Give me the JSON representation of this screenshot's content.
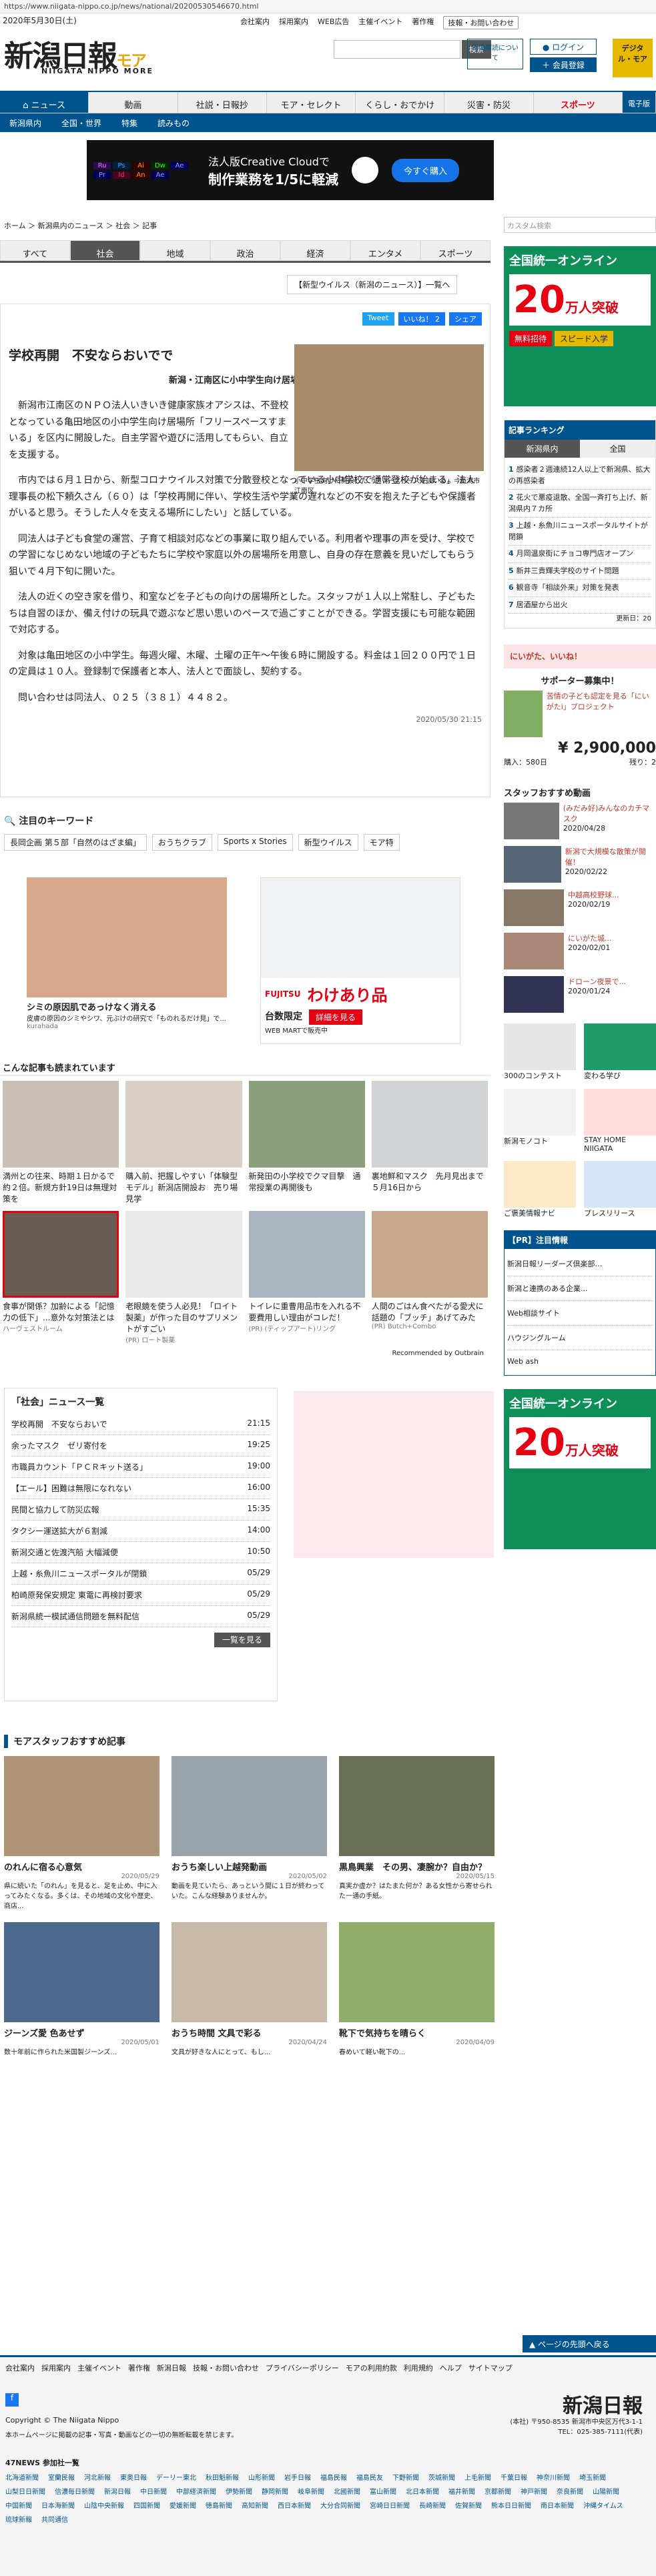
{
  "browser": {
    "url": "https://www.niigata-nippo.co.jp/news/national/20200530546670.html"
  },
  "header": {
    "date": "2020年5月30日(土)",
    "top_links": [
      "会社案内",
      "採用案内",
      "WEB広告",
      "主催イベント",
      "著作権"
    ],
    "contact_link": "技報・お問い合わせ",
    "logo_main": "新潟日報",
    "logo_more": "モア",
    "logo_sub": "NIIGATA NIPPO MORE",
    "search_btn": "検索",
    "member_btn": "新聞購読について",
    "login_btn": "ログイン",
    "register_btn": "会員登録",
    "digital_badge": "デジタル・モア"
  },
  "nav": {
    "items": [
      "ニュース",
      "動画",
      "社説・日報抄",
      "モア・セレクト",
      "くらし・おでかけ",
      "災害・防災",
      "スポーツ"
    ],
    "epaper": "電子版",
    "sub_items": [
      "新潟県内",
      "全国・世界",
      "特集",
      "読みもの"
    ]
  },
  "ad_banner": {
    "apps": [
      "Ru",
      "Ps",
      "Ai",
      "Dw",
      "Ae",
      "Pr",
      "Id",
      "An",
      "Ae"
    ],
    "text1": "法人版Creative Cloudで",
    "text2": "制作業務を1/5に軽減",
    "cta": "今すぐ購入"
  },
  "breadcrumb": [
    "ホーム",
    "新潟県内のニュース",
    "社会",
    "記事"
  ],
  "category_tabs": [
    "すべて",
    "社会",
    "地域",
    "政治",
    "経済",
    "エンタメ",
    "スポーツ"
  ],
  "corona_link": "【新型ウイルス（新潟のニュース）】一覧へ",
  "article": {
    "title": "学校再開　不安ならおいでで",
    "dateline": "新潟・江南区に小中学生向け居場所",
    "share": [
      "Tweet",
      "いいね！ 2",
      "シェア"
    ],
    "photo_caption": "小中学生向けに開設した「フリースペースすまいる」＝新潟市江南区",
    "paragraphs": [
      "新潟市江南区のＮＰＯ法人いきいき健康家族オアシスは、不登校となっている亀田地区の小中学生向け居場所「フリースペースすまいる」を区内に開設した。自主学習や遊びに活用してもらい、自立を支援する。",
      "市内では６月１日から、新型コロナウイルス対策で分散登校となっている小中学校で通常登校が始まる。法人理事長の松下頼久さん（６０）は「学校再開に伴い、学校生活や学業の遅れなどの不安を抱えた子どもや保護者がいると思う。そうした人々を支える場所にしたい」と話している。",
      "同法人は子ども食堂の運営、子育て相談対応などの事業に取り組んでいる。利用者や理事の声を受け、学校での学習になじめない地域の子どもたちに学校や家庭以外の居場所を用意し、自身の存在意義を見いだしてもらう狙いで４月下旬に開いた。",
      "法人の近くの空き家を借り、和室などを子どもの向けの居場所とした。スタッフが１人以上常駐し、子どもたちは自習のほか、備え付けの玩具で遊ぶなど思い思いのペースで過ごすことができる。学習支援にも可能な範囲で対応する。",
      "対象は亀田地区の小中学生。毎週火曜、木曜、土曜の正午～午後６時に開設する。料金は１回２００円で１日の定員は１０人。登録制で保護者と本人、法人とで面談し、契約する。",
      "問い合わせは同法人、０２５（３８１）４４８２。"
    ],
    "timestamp": "2020/05/30 21:15"
  },
  "keywords": {
    "title": "注目のキーワード",
    "items": [
      "長岡企画 第５部「自然のはざま編」",
      "おうちクラブ",
      "Sports x Stories",
      "新型ウイルス",
      "モア特"
    ]
  },
  "promo_ads": [
    {
      "title": "シミの原因肌であっけなく消える",
      "desc": "皮膚の原因のシミやシワ、元ぶけの研究で「ものれるだけ見」で...",
      "source": "kurahada"
    },
    {
      "brand": "FUJITSU",
      "title": "わけあり品",
      "sub": "台数限定",
      "cta": "詳細を見る",
      "store": "WEB MARTで販売中"
    }
  ],
  "recommend": {
    "title": "こんな記事も読まれています",
    "items": [
      {
        "title": "満州との往来、時期１日かるで約２倍。新規方針19日は無理対策を"
      },
      {
        "title": "購入前、把握しやすい「体験型モデル」新潟店開設お　売り場見学"
      },
      {
        "title": "新発田の小学校でクマ目撃　通常授業の再開後も"
      },
      {
        "title": "裏地鮮和マスク　先月見出まで５月16日から"
      },
      {
        "title": "食事が関係？加齢による「記憶力の低下」...意外な対策法とは",
        "source": "ハーヴェストルーム"
      },
      {
        "title": "老眼鏡を使う人必見！「ロイト製薬」が作った目のサプリメントがすごい",
        "source": "(PR) ロート製薬"
      },
      {
        "title": "トイレに重曹用品市を入れる不要費用しい理由がコレだ！",
        "source": "(PR) (ティップアート)リング"
      },
      {
        "title": "人間のごはん食べたがる愛犬に話題の「ブッチ」あげてみた",
        "source": "(PR) Butch+Combo"
      }
    ],
    "recommended_by": "Recommended by Outbrain"
  },
  "society_news": {
    "title": "「社会」ニュース一覧",
    "items": [
      {
        "title": "学校再開　不安ならおいで",
        "time": "21:15"
      },
      {
        "title": "余ったマスク　ゼリ寄付を",
        "time": "19:25"
      },
      {
        "title": "市職員カウント「ＰＣＲキット送る」",
        "time": "19:00"
      },
      {
        "title": "【エール】困難は無限になれない",
        "time": "16:00"
      },
      {
        "title": "民間と協力して防災広報",
        "time": "15:35"
      },
      {
        "title": "タクシー運送拡大が６割減",
        "time": "14:00"
      },
      {
        "title": "新潟交通と佐渡汽船 大幅減便",
        "time": "10:50"
      },
      {
        "title": "上越・糸魚川ニュースポータルが閉鎖",
        "time": "05/29"
      },
      {
        "title": "柏崎原発保安規定 東電に再検討要求",
        "time": "05/29"
      },
      {
        "title": "新潟県統一模試通信問題を無料配信",
        "time": "05/29"
      }
    ],
    "more": "一覧を見る"
  },
  "staff_picks": {
    "title": "モアスタッフおすすめ記事",
    "items": [
      {
        "title": "のれんに宿る心意気",
        "date": "2020/05/29",
        "text": "県に続いた「のれん」を見ると、足を止め、中に入ってみたくなる。多くは、その地域の文化や歴史、商店..."
      },
      {
        "title": "おうち楽しい上越発動画",
        "date": "2020/05/02",
        "text": "動画を見ていたら、あっという間に１日が終わっていた。こんな経験ありませんか。"
      },
      {
        "title": "黒鳥興業　その男、凄腕か？自由か？",
        "date": "2020/05/15",
        "text": "真実か虚か？はたまた何か？ある女性から寄せられた一通の手紙。"
      },
      {
        "title": "ジーンズ愛 色あせず",
        "date": "2020/05/01",
        "text": "数十年前に作られた米国製ジーンズ..."
      },
      {
        "title": "おうち時間 文具で彩る",
        "date": "2020/04/24",
        "text": "文具が好きな人にとって、もし..."
      },
      {
        "title": "靴下で気持ちを晴らく",
        "date": "2020/04/09",
        "text": "春めいて軽い靴下の..."
      }
    ]
  },
  "sidebar": {
    "search_placeholder": "カスタム検索",
    "ad1": {
      "headline": "全国統一オンライン",
      "big": "20",
      "unit": "万人突破",
      "badge": "無料招待",
      "cta": "スピード入学"
    },
    "ranking": {
      "title": "記事ランキング",
      "tabs": [
        "新潟県内",
        "全国"
      ],
      "items": [
        "感染者２週連続12人以上で新潟県、拡大の再感染者",
        "花火で悪疫退散、全国一斉打ち上げ、新潟県内７カ所",
        "上越・糸魚川ニュースポータルサイトが閉鎖",
        "月岡温泉街にチョコ専門店オープン",
        "新井三貴輝夫学校のサイト問題",
        "観音寺「相談外来」対策を発表",
        "居酒屋から出火"
      ],
      "updated": "更新日：20"
    },
    "niigata_panel": "にいがた、いいね！",
    "supporter_title": "サポーター募集中！",
    "crowdfunding": {
      "text": "苦情の子ども認定を見る「にいがたi」プロジェクト",
      "price": "¥ 2,900,000",
      "people": "購入：580日",
      "days": "残り：2"
    },
    "staff_video_title": "スタッフおすすめ動画",
    "videos": [
      {
        "title": "(みだみ好)みんなのカチマスク",
        "date": "2020/04/28"
      },
      {
        "title": "新潟で大規模な散策が開催！",
        "date": "2020/02/22"
      },
      {
        "title": "中越高校野球...",
        "date": "2020/02/19"
      },
      {
        "title": "にいがた城...",
        "date": "2020/02/01"
      },
      {
        "title": "ドローン夜景で...",
        "date": "2020/01/24"
      }
    ],
    "tiles": [
      "300のコンテスト",
      "変わる学び",
      "新潟モノコト",
      "STAY HOME NIIGATA",
      "ご褒美情報ナビ",
      "プレスリリース"
    ],
    "pr_title": "【PR】注目情報",
    "pr_items": [
      "新潟日報リーダーズ倶楽部…",
      "新潟と連携のある企業...",
      "Web相談サイト",
      "ハウジングルーム",
      "Web ash"
    ],
    "back_to_top": "ページの先頭へ戻る"
  },
  "footer": {
    "links": [
      "会社案内",
      "採用案内",
      "主催イベント",
      "著作権",
      "新潟日報",
      "技報・お問い合わせ",
      "プライバシーポリシー",
      "モアの利用約款",
      "利用規約",
      "ヘルプ",
      "サイトマップ"
    ],
    "copyright": "Copyright © The Niigata Nippo",
    "notice": "本ホームページに掲載の記事・写真・動画などの一切の無断転載を禁じます。",
    "address": "(本社) 〒950-8535 新潟市中央区万代3-1-1",
    "tel": "TEL：025-385-7111(代表)",
    "news_title": "47NEWS 参加社一覧",
    "partners": [
      "北海道新聞",
      "室蘭民報",
      "河北新報",
      "東奥日報",
      "デーリー東北",
      "秋田魁新報",
      "山形新聞",
      "岩手日報",
      "福島民報",
      "福島民友",
      "下野新聞",
      "茨城新聞",
      "上毛新聞",
      "千葉日報",
      "神奈川新聞",
      "埼玉新聞",
      "山梨日日新聞",
      "信濃毎日新聞",
      "新潟日報",
      "中日新聞",
      "中部経済新聞",
      "伊勢新聞",
      "静岡新聞",
      "岐阜新聞",
      "北國新聞",
      "富山新聞",
      "北日本新聞",
      "福井新聞",
      "京都新聞",
      "神戸新聞",
      "奈良新聞",
      "山陽新聞",
      "中国新聞",
      "日本海新聞",
      "山陰中央新報",
      "四国新聞",
      "愛媛新聞",
      "徳島新聞",
      "高知新聞",
      "西日本新聞",
      "大分合同新聞",
      "宮崎日日新聞",
      "長崎新聞",
      "佐賀新聞",
      "熊本日日新聞",
      "南日本新聞",
      "沖縄タイムス",
      "琉球新報",
      "共同通信"
    ]
  }
}
